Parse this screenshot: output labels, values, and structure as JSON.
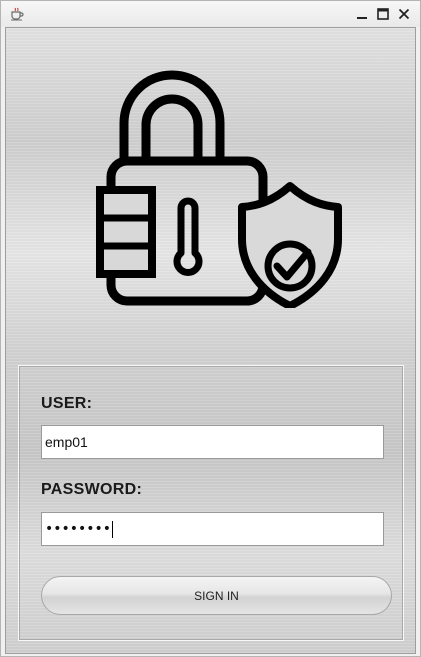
{
  "window": {
    "title_icon": "java-coffee-cup-icon",
    "controls": [
      "minimize-icon",
      "maximize-icon",
      "close-icon"
    ]
  },
  "graphic": {
    "icon": "padlock-with-shield-checkmark-icon"
  },
  "login": {
    "user_label": "USER:",
    "user_value": "emp01",
    "password_label": "PASSWORD:",
    "password_masked": "••••••••",
    "signin_label": "SIGN IN"
  },
  "colors": {
    "icon_stroke": "#000000",
    "field_background": "#ffffff"
  }
}
